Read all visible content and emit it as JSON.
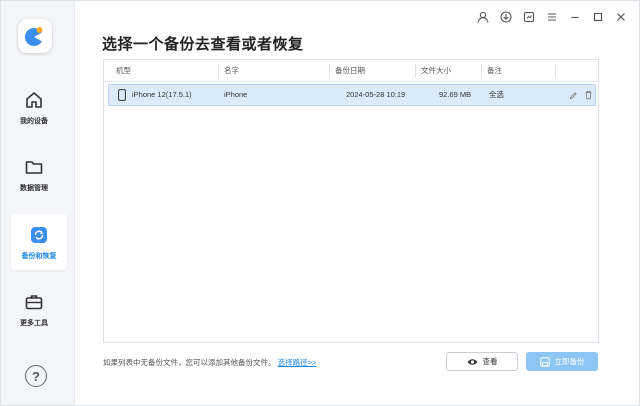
{
  "sidebar": {
    "items": [
      {
        "label": "我的设备",
        "icon": "home-icon"
      },
      {
        "label": "数据管理",
        "icon": "folder-icon"
      },
      {
        "label": "备份和恢复",
        "icon": "backup-restore-icon",
        "active": true
      },
      {
        "label": "更多工具",
        "icon": "toolbox-icon"
      }
    ],
    "help": "?"
  },
  "header": {
    "title": "选择一个备份去查看或者恢复"
  },
  "table": {
    "columns": [
      "机型",
      "名字",
      "备份日期",
      "文件大小",
      "备注"
    ],
    "rows": [
      {
        "model": "iPhone 12(17.5.1)",
        "name": "iPhone",
        "date": "2024-05-28 10:19",
        "size": "92.69 MB",
        "note": "全选"
      }
    ]
  },
  "footer": {
    "note": "如果列表中无备份文件，您可以添加其他备份文件。",
    "link": "选择路径>>",
    "view_label": "查看",
    "backup_label": "立即备份"
  },
  "colors": {
    "accent": "#1e88e5",
    "selected_row": "#dcebfb",
    "backup_button": "#8dc6f5"
  }
}
